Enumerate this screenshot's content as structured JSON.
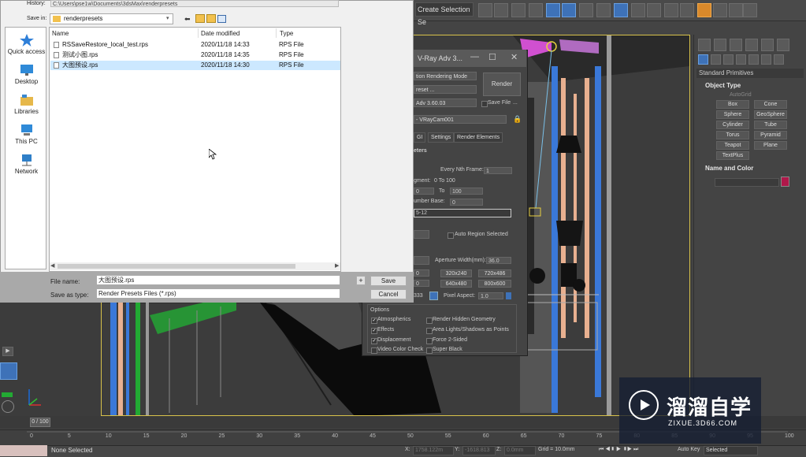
{
  "save_dialog": {
    "history_label": "History:",
    "history_value": "C:\\Users\\pse1w\\Documents\\3dsMax\\renderpresets",
    "save_in_label": "Save in:",
    "save_in_value": "renderpresets",
    "places": [
      "Quick access",
      "Desktop",
      "Libraries",
      "This PC",
      "Network"
    ],
    "columns": [
      "Name",
      "Date modified",
      "Type"
    ],
    "files": [
      {
        "name": "RSSaveRestore_local_test.rps",
        "date": "2020/11/18 14:33",
        "type": "RPS File"
      },
      {
        "name": "测试小图.rps",
        "date": "2020/11/18 14:35",
        "type": "RPS File"
      },
      {
        "name": "大图预设.rps",
        "date": "2020/11/18 14:30",
        "type": "RPS File"
      }
    ],
    "file_name_label": "File name:",
    "file_name_value": "大图预设.rps",
    "save_type_label": "Save as type:",
    "save_type_value": "Render Presets Files (*.rps)",
    "save_button": "Save",
    "cancel_button": "Cancel",
    "plus_button": "+"
  },
  "render_dialog": {
    "title": "V-Ray Adv 3...",
    "mode": "tion Rendering Mode",
    "render_button": "Render",
    "preset": "reset ...",
    "save_file": "Save File",
    "renderer": "Adv 3.60.03",
    "camera": "- VRayCam001",
    "tabs": [
      "GI",
      "Settings",
      "Render Elements"
    ],
    "section": "eters",
    "every_nth_label": "Every Nth Frame:",
    "every_nth_value": "1",
    "segment_label": "gment:",
    "segment_value": "0 To 100",
    "range_to": "To",
    "range_end": "100",
    "range_start": "0",
    "number_base_label": "umber Base:",
    "number_base_value": "0",
    "frames_value": "5-12",
    "auto_region": "Auto Region Selected",
    "aperture_label": "Aperture Width(mm):",
    "aperture_value": "36.0",
    "res_buttons": [
      "320x240",
      "720x486",
      "640x480",
      "800x600"
    ],
    "res_w": "0",
    "res_h": "0",
    "pixel_aspect_prefix": "333",
    "pixel_aspect_label": "Pixel Aspect:",
    "pixel_aspect_value": "1.0",
    "options_label": "Options",
    "options": [
      {
        "label": "Atmospherics",
        "checked": true
      },
      {
        "label": "Render Hidden Geometry",
        "checked": false
      },
      {
        "label": "Effects",
        "checked": true
      },
      {
        "label": "Area Lights/Shadows as Points",
        "checked": false
      },
      {
        "label": "Displacement",
        "checked": true
      },
      {
        "label": "Force 2-Sided",
        "checked": false
      },
      {
        "label": "Video Color Check",
        "checked": false
      },
      {
        "label": "Super Black",
        "checked": false
      }
    ]
  },
  "toolbar": {
    "selection_set": "Create Selection Se"
  },
  "command_panel": {
    "category": "Standard Primitives",
    "object_type": "Object Type",
    "autogrid": "AutoGrid",
    "objects": [
      "Box",
      "Cone",
      "Sphere",
      "GeoSphere",
      "Cylinder",
      "Tube",
      "Torus",
      "Pyramid",
      "Teapot",
      "Plane",
      "TextPlus"
    ],
    "name_color": "Name and Color",
    "swatch_color": "#b0184a"
  },
  "timeline": {
    "frame": "0 / 100",
    "ticks": [
      "0",
      "5",
      "10",
      "15",
      "20",
      "25",
      "30",
      "35",
      "40",
      "45",
      "50",
      "55",
      "60",
      "65",
      "70",
      "75",
      "80",
      "85",
      "90",
      "95",
      "100"
    ]
  },
  "status": {
    "selection": "None Selected",
    "x_label": "X:",
    "x_value": "1758.122m",
    "y_label": "Y:",
    "y_value": "-1618.813",
    "z_label": "Z:",
    "z_value": "0.0mm",
    "grid": "Grid = 10.0mm",
    "auto_key": "Auto Key",
    "selected": "Selected"
  },
  "watermark": {
    "title": "溜溜自学",
    "url": "ZIXUE.3D66.COM"
  }
}
